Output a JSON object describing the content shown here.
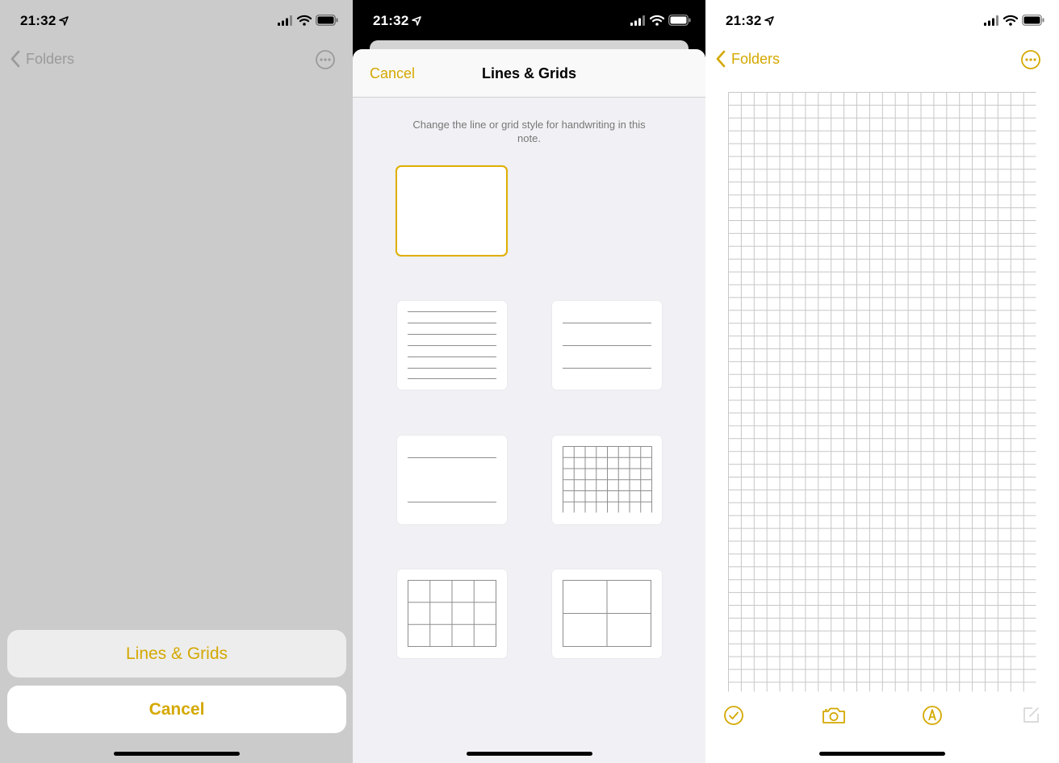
{
  "status_bar": {
    "time": "21:32"
  },
  "colors": {
    "accent": "#d4a800",
    "dimmed_panel_bg": "#cbcbcb",
    "sheet_bg": "#f1f1f5",
    "selected_border": "#e0b000",
    "grid_line": "#c7c7c7"
  },
  "panel_action_sheet": {
    "nav": {
      "back_label": "Folders",
      "back_icon": "chevron-left-icon",
      "more_icon": "ellipsis-circle-icon"
    },
    "action_sheet": {
      "option_label": "Lines & Grids",
      "cancel_label": "Cancel"
    }
  },
  "panel_lines_grids": {
    "header": {
      "cancel_label": "Cancel",
      "title": "Lines & Grids"
    },
    "description": "Change the line or grid style for handwriting in this note.",
    "options": [
      {
        "style": "blank",
        "selected": true
      },
      {
        "style": "lines-small",
        "selected": false
      },
      {
        "style": "lines-medium",
        "selected": false
      },
      {
        "style": "lines-large",
        "selected": false
      },
      {
        "style": "grid-small",
        "selected": false
      },
      {
        "style": "grid-medium",
        "selected": false
      },
      {
        "style": "grid-large",
        "selected": false
      }
    ]
  },
  "panel_note": {
    "nav": {
      "back_label": "Folders",
      "back_icon": "chevron-left-icon",
      "more_icon": "ellipsis-circle-icon"
    },
    "background_style": "grid-small",
    "toolbar": {
      "icons": [
        "checklist-icon",
        "camera-icon",
        "markup-icon",
        "compose-icon"
      ]
    }
  }
}
